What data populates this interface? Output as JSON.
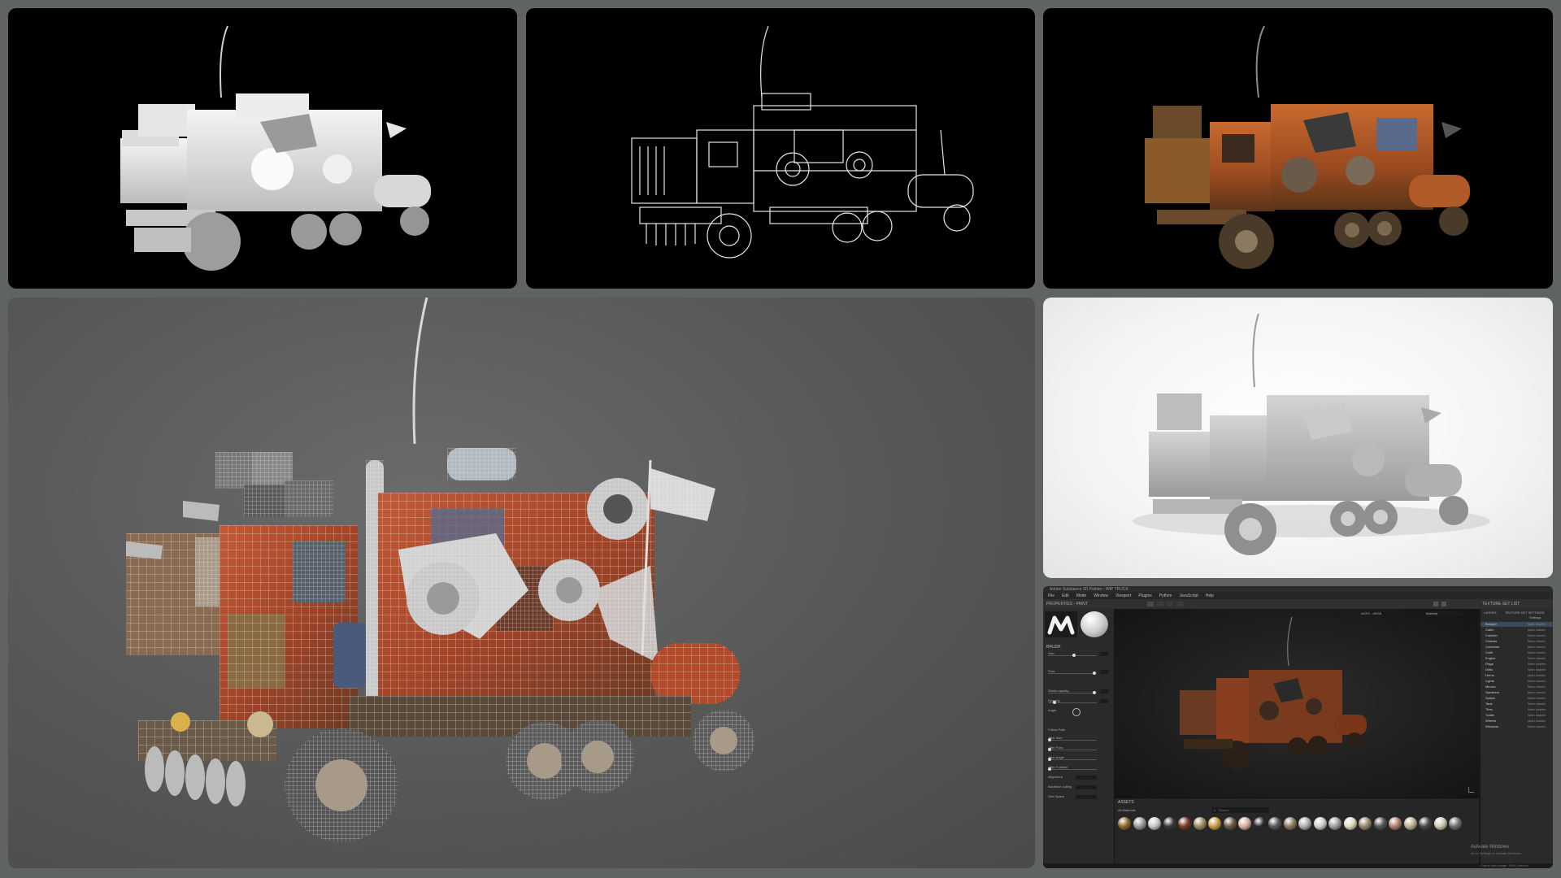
{
  "collage": {
    "background_color": "#5f6460",
    "panels": [
      {
        "id": "ao",
        "style": "white silhouette / ambient occlusion render on black"
      },
      {
        "id": "wire-black",
        "style": "white-on-black line wireframe render"
      },
      {
        "id": "textured",
        "style": "rusted orange PBR textured render on black"
      },
      {
        "id": "wire-textured",
        "style": "textured truck with wireframe overlay on grey gradient"
      },
      {
        "id": "clay",
        "style": "grey clay render on white studio backdrop"
      },
      {
        "id": "painter",
        "style": "Adobe Substance 3D Painter screenshot"
      }
    ]
  },
  "painter": {
    "title_bar": "Adobe Substance 3D Painter - WIP TRUCK",
    "menu": [
      "File",
      "Edit",
      "Mode",
      "Window",
      "Viewport",
      "Plugins",
      "Python",
      "JavaScript",
      "Help"
    ],
    "left_panel_title": "PROPERTIES - PAINT",
    "left_sections": [
      "BRUSH",
      "Size",
      "Flow",
      "Stroke opacity",
      "Spacing",
      "Angle",
      "Follow Path",
      "Jitter Size",
      "Jitter Flow",
      "Jitter Angle",
      "Jitter Position",
      "Alignment",
      "Backface culling",
      "Size Space"
    ],
    "viewport_dropdowns": [
      "ACES - sRGB",
      "Material"
    ],
    "right_panel_tabs": [
      "TEXTURE SET LIST",
      "LAYERS",
      "TEXTURE SET SETTINGS"
    ],
    "right_panel_header": "Settings",
    "texture_sets": [
      {
        "name": "Bumper",
        "shader": "Main shader"
      },
      {
        "name": "Cabin",
        "shader": "Main shader"
      },
      {
        "name": "Canister",
        "shader": "Main shader"
      },
      {
        "name": "Chassis",
        "shader": "Main shader"
      },
      {
        "name": "Container",
        "shader": "Main shader"
      },
      {
        "name": "Cloth",
        "shader": "Main shader"
      },
      {
        "name": "Engine",
        "shader": "Main shader"
      },
      {
        "name": "Flags",
        "shader": "Main shader"
      },
      {
        "name": "Grills",
        "shader": "Main shader"
      },
      {
        "name": "Horns",
        "shader": "Main shader"
      },
      {
        "name": "Lights",
        "shader": "Main shader"
      },
      {
        "name": "Mirrors",
        "shader": "Main shader"
      },
      {
        "name": "Speakers",
        "shader": "Main shader"
      },
      {
        "name": "Spikes",
        "shader": "Main shader"
      },
      {
        "name": "Tank",
        "shader": "Main shader"
      },
      {
        "name": "Tires",
        "shader": "Main shader"
      },
      {
        "name": "Trailer",
        "shader": "Main shader"
      },
      {
        "name": "Wheels",
        "shader": "Main shader"
      },
      {
        "name": "Windows",
        "shader": "Main shader"
      }
    ],
    "assets_title": "ASSETS",
    "assets_search_placeholder": "Search",
    "assets_filter": "All Materials",
    "material_swatches": [
      "#8a6a2a",
      "#9a9a9a",
      "#c8c8c8",
      "#3a3a3a",
      "#7a3a2a",
      "#a08a60",
      "#c7a040",
      "#6a5a40",
      "#d9b0a0",
      "#2a2a2a",
      "#5a5a5a",
      "#8a7a60",
      "#b0b0b0",
      "#d0d0c8",
      "#a0a0a0",
      "#e0d8c0",
      "#9a8870",
      "#555555",
      "#b08070",
      "#c0b090",
      "#4a4a4a",
      "#cfc9b0",
      "#707070"
    ],
    "windows_watermark_title": "Activate Windows",
    "windows_watermark_sub": "Go to Settings to activate Windows.",
    "status_bar": "Cache disk usage: 18% | Version"
  }
}
